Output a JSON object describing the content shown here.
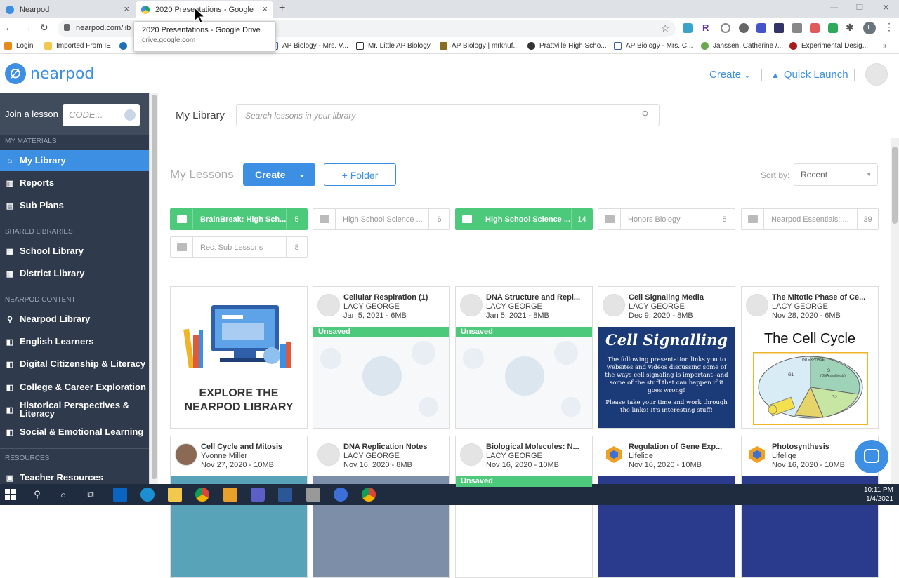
{
  "browser": {
    "tabs": [
      {
        "title": "Nearpod",
        "active": false
      },
      {
        "title": "2020 Presentations - Google Dri",
        "active": true
      }
    ],
    "new_tab": "+",
    "address": "nearpod.com/lib",
    "tooltip": {
      "title": "2020 Presentations - Google Drive",
      "url": "drive.google.com"
    },
    "bookmarks": [
      "Login",
      "Imported From IE",
      "AP Biology - Mrs. V...",
      "Mr. Little AP Biology",
      "AP Biology | mrknuf...",
      "Prattville High Scho...",
      "AP Biology - Mrs. C...",
      "Janssen, Catherine /...",
      "Experimental Desig..."
    ],
    "profile_initial": "L"
  },
  "header": {
    "logo_text": "nearpod",
    "create_label": "Create",
    "quick_launch_label": "Quick Launch"
  },
  "sidebar": {
    "join_label": "Join a lesson",
    "code_placeholder": "CODE...",
    "sections": {
      "my_materials": "MY MATERIALS",
      "shared": "SHARED LIBRARIES",
      "content": "NEARPOD CONTENT",
      "resources": "RESOURCES"
    },
    "my_materials": [
      "My Library",
      "Reports",
      "Sub Plans"
    ],
    "shared": [
      "School Library",
      "District Library"
    ],
    "content": [
      "Nearpod Library",
      "English Learners",
      "Digital Citizenship & Literacy",
      "College & Career Exploration",
      "Historical Perspectives & Literacy",
      "Social & Emotional Learning"
    ],
    "resources": [
      "Teacher Resources"
    ]
  },
  "library": {
    "title": "My Library",
    "search_placeholder": "Search lessons in your library",
    "my_lessons": "My Lessons",
    "create_btn": "Create",
    "folder_btn": "+ Folder",
    "sort_label": "Sort by:",
    "sort_value": "Recent",
    "folders": [
      {
        "name": "BrainBreak: High Sch...",
        "count": "5",
        "green": true
      },
      {
        "name": "High School Science ...",
        "count": "6",
        "green": false
      },
      {
        "name": "High School Science ...",
        "count": "14",
        "green": true
      },
      {
        "name": "Honors Biology",
        "count": "5",
        "green": false
      },
      {
        "name": "Nearpod Essentials: ...",
        "count": "39",
        "green": false
      },
      {
        "name": "Rec. Sub Lessons",
        "count": "8",
        "green": false
      }
    ],
    "explore": {
      "line1": "EXPLORE THE",
      "line2": "NEARPOD LIBRARY"
    },
    "unsaved": "Unsaved",
    "cards": [
      {
        "title": "Cellular Respiration (1)",
        "author": "LACY GEORGE",
        "meta": "Jan 5, 2021 - 6MB"
      },
      {
        "title": "DNA Structure and Repl...",
        "author": "LACY GEORGE",
        "meta": "Jan 5, 2021 - 8MB"
      },
      {
        "title": "Cell Signaling Media",
        "author": "LACY GEORGE",
        "meta": "Dec 9, 2020 - 8MB"
      },
      {
        "title": "The Mitotic Phase of Ce...",
        "author": "LACY GEORGE",
        "meta": "Nov 28, 2020 - 6MB"
      },
      {
        "title": "Cell Cycle and Mitosis",
        "author": "Yvonne Miller",
        "meta": "Nov 27, 2020 - 10MB"
      },
      {
        "title": "DNA Replication Notes",
        "author": "LACY GEORGE",
        "meta": "Nov 16, 2020 - 8MB"
      },
      {
        "title": "Biological Molecules: N...",
        "author": "LACY GEORGE",
        "meta": "Nov 16, 2020 - 10MB"
      },
      {
        "title": "Regulation of Gene Exp...",
        "author": "Lifeliqe",
        "meta": "Nov 16, 2020 - 10MB"
      },
      {
        "title": "Photosynthesis",
        "author": "Lifeliqe",
        "meta": "Nov 16, 2020 - 10MB"
      }
    ],
    "cell_signalling": {
      "heading": "Cell Signalling",
      "body": "The following presentation links you to websites and videos discussing some of the ways cell signaling is important--and some of the stuff that can happen if it goes wrong!",
      "footer": "Please take your time and work through the links!  It's interesting stuff!"
    },
    "cell_cycle": {
      "heading": "The Cell Cycle",
      "interphase": "INTERPHASE",
      "s": "S",
      "s_sub": "(DNA synthesis)",
      "g1": "G1",
      "g2": "G2"
    }
  },
  "taskbar": {
    "time": "10:11 PM",
    "date": "1/4/2021"
  }
}
